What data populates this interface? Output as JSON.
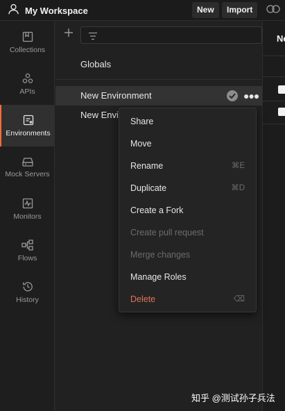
{
  "header": {
    "workspace_title": "My Workspace",
    "new_label": "New",
    "import_label": "Import"
  },
  "sidebar": {
    "items": [
      {
        "label": "Collections",
        "icon": "collections-icon"
      },
      {
        "label": "APIs",
        "icon": "apis-icon"
      },
      {
        "label": "Environments",
        "icon": "environments-icon",
        "active": true
      },
      {
        "label": "Mock Servers",
        "icon": "mock-servers-icon"
      },
      {
        "label": "Monitors",
        "icon": "monitors-icon"
      },
      {
        "label": "Flows",
        "icon": "flows-icon"
      },
      {
        "label": "History",
        "icon": "history-icon"
      }
    ]
  },
  "list": {
    "globals_label": "Globals",
    "environments": [
      {
        "label": "New Environment",
        "selected": true
      },
      {
        "label": "New Envir"
      }
    ]
  },
  "right_panel": {
    "header_fragment": "Ne"
  },
  "context_menu": {
    "items": [
      {
        "label": "Share",
        "shortcut": "",
        "state": "enabled"
      },
      {
        "label": "Move",
        "shortcut": "",
        "state": "enabled"
      },
      {
        "label": "Rename",
        "shortcut": "⌘E",
        "state": "enabled"
      },
      {
        "label": "Duplicate",
        "shortcut": "⌘D",
        "state": "enabled"
      },
      {
        "label": "Create a Fork",
        "shortcut": "",
        "state": "enabled"
      },
      {
        "label": "Create pull request",
        "shortcut": "",
        "state": "disabled"
      },
      {
        "label": "Merge changes",
        "shortcut": "",
        "state": "disabled"
      },
      {
        "label": "Manage Roles",
        "shortcut": "",
        "state": "enabled"
      },
      {
        "label": "Delete",
        "shortcut": "⌫",
        "state": "danger"
      }
    ]
  },
  "watermark": "知乎 @测试孙子兵法",
  "colors": {
    "background": "#212121",
    "sidebar": "#1e1e1e",
    "active_accent": "#ff6c37",
    "danger": "#e2725b",
    "muted": "#6c6c6c"
  }
}
